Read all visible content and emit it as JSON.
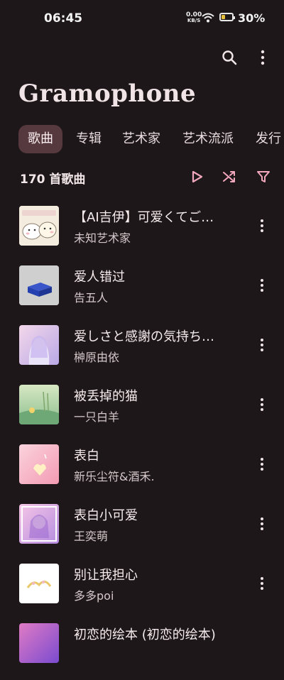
{
  "status": {
    "time": "06:45",
    "net_speed_value": "0.00",
    "net_speed_unit": "KB/S",
    "battery": "30%",
    "battery_level_fraction": 0.3
  },
  "toolbar": {
    "search_icon": "search-icon",
    "more_icon": "more-vertical-icon"
  },
  "app": {
    "title": "Gramophone"
  },
  "tabs": [
    {
      "label": "歌曲",
      "active": true
    },
    {
      "label": "专辑"
    },
    {
      "label": "艺术家"
    },
    {
      "label": "艺术流派"
    },
    {
      "label": "发行"
    }
  ],
  "songs_header": {
    "count": "170 首歌曲",
    "play_icon": "play-icon",
    "shuffle_icon": "shuffle-icon",
    "filter_icon": "filter-icon",
    "accent_color": "#f3a7bd"
  },
  "songs": [
    {
      "title": "【AI吉伊】可爱くてご…",
      "artist": "未知艺术家",
      "art": "cartoon-cover"
    },
    {
      "title": "爱人错过",
      "artist": "告五人",
      "art": "blue-cube-cover"
    },
    {
      "title": "爱しさと感謝の気持ち…",
      "artist": "榊原由依",
      "art": "anime-girl-cover"
    },
    {
      "title": "被丢掉的猫",
      "artist": "一只白羊",
      "art": "green-painting-cover"
    },
    {
      "title": "表白",
      "artist": "新乐尘符&酒禾.",
      "art": "pink-cover"
    },
    {
      "title": "表白小可爱",
      "artist": "王奕萌",
      "art": "purple-girl-cover"
    },
    {
      "title": "别让我担心",
      "artist": "多多poi",
      "art": "white-cover"
    },
    {
      "title": "初恋的绘本 (初恋的绘本)",
      "artist": "",
      "art": "anime-cover"
    }
  ]
}
